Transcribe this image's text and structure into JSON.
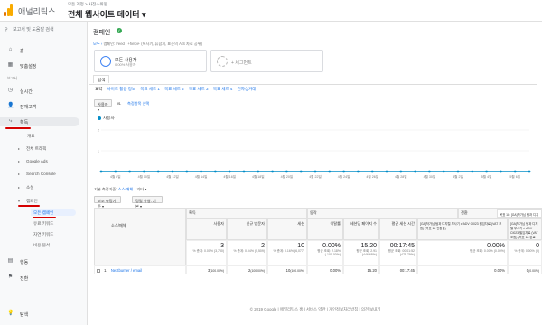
{
  "app": {
    "name": "애널리틱스",
    "breadcrumb": "모든 계정 > 사전스위밍",
    "view_title": "전체 웹사이트 데이터 ▾"
  },
  "sidebar": {
    "search_placeholder": "보고서 및 도움말 검색",
    "items": [
      {
        "label": "홈",
        "icon": "home-icon",
        "glyph": "⌂"
      },
      {
        "label": "맞춤설정",
        "icon": "grid-icon",
        "glyph": "▦"
      }
    ],
    "section_label": "보고서",
    "report_items": [
      {
        "label": "실시간",
        "icon": "clock-icon",
        "glyph": "◷"
      },
      {
        "label": "잠재고객",
        "icon": "person-icon",
        "glyph": "👤"
      },
      {
        "label": "획득",
        "icon": "acquisition-icon",
        "glyph": "⤷"
      }
    ],
    "acq_sub": [
      "개요",
      "전체 트래픽",
      "Google Ads",
      "Search Console",
      "소셜",
      "캠페인"
    ],
    "campaign_leaves": [
      "모든 캠페인",
      "유료 키워드",
      "자연 키워드",
      "비용 분석"
    ],
    "bottom_items": [
      {
        "label": "행동",
        "icon": "behavior-icon",
        "glyph": "▤"
      },
      {
        "label": "전환",
        "icon": "flag-icon",
        "glyph": "⚑"
      },
      {
        "label": "탐색",
        "icon": "lightbulb-icon",
        "glyph": "💡"
      }
    ]
  },
  "page": {
    "title": "캠페인",
    "saved_prefix": "모두 ›",
    "saved_text": "캠페인: Feed : +helpi+ (특사기, 퓨합기, 표준의 A/S 자료 공위)",
    "segments": [
      {
        "title": "모든 사용자",
        "subtitle": "0.00% 사용자"
      },
      {
        "title": "+ 세그먼트",
        "subtitle": ""
      }
    ],
    "main_tab": "탐색",
    "subtabs": [
      "요약",
      "사이트 활용 정보",
      "목표 세트 1",
      "목표 세트 2",
      "목표 세트 3",
      "목표 세트 4",
      "전자상거래"
    ]
  },
  "chart_controls": {
    "metric": "사용자 ▾",
    "vs_label": "vs.",
    "choose_metric": "측정항목 선택"
  },
  "chart_data": {
    "type": "line",
    "series": [
      {
        "name": "사용자",
        "values": [
          0,
          0,
          0,
          0,
          0,
          0,
          0,
          0,
          0,
          0,
          0,
          0,
          0,
          0,
          0,
          0,
          0,
          0,
          0,
          0,
          0,
          0,
          0,
          0,
          0,
          0,
          0,
          0,
          0,
          0,
          0
        ]
      }
    ],
    "x": [
      "4월 7일",
      "4월 8일",
      "4월 9일",
      "4월 10일",
      "4월 11일",
      "4월 12일",
      "4월 13일",
      "4월 14일",
      "4월 15일",
      "4월 16일",
      "4월 17일",
      "4월 18일",
      "4월 19일",
      "4월 20일",
      "4월 21일",
      "4월 22일",
      "4월 23일",
      "4월 24일",
      "4월 25일",
      "4월 26일",
      "4월 27일",
      "4월 28일",
      "4월 29일",
      "4월 30일",
      "5월 1일",
      "5월 2일",
      "5월 3일",
      "5월 4일",
      "5월 5일",
      "5월 6일",
      "5월 7일"
    ],
    "yticks": [
      "2",
      "1"
    ],
    "ylim": [
      0,
      2
    ],
    "color": "#058dc7"
  },
  "table_controls": {
    "primary_dim": "기본 측정기준:",
    "dim_value": "소스/매체",
    "other": "기타 ▾",
    "secondary": "보조 측정기준 ▾",
    "sort": "정렬 유형:",
    "sort_value": "기본 ▾"
  },
  "table": {
    "dim_header": "소스/매체",
    "group_acq": "획득",
    "group_behavior": "동작",
    "group_conv": "전환",
    "goal_select": "목표 18: [GA]작가님 텀과 디지털 부사기 ≠ ADV CI023 필임자료(VAT ▾",
    "columns": [
      "사용자",
      "신규 방문자",
      "세션",
      "이탈률",
      "세션당 페이지 수",
      "평균 세션 시간"
    ],
    "conv_col1": "[GA]작가님 텀과 디지털 부사기 ≠ ADV CI023 필임자료 (VAT 포함) (목표 18 전환율)",
    "conv_col2": "[GA]작가님 텀과 디지털 부사기 ≠ ADV CI023 필임자료 (VAT 포함) (목표 18 완료 수)",
    "totals": {
      "users": "3",
      "users_sub": "% 총계: 0.00% (3,730)",
      "new": "2",
      "new_sub": "% 총계: 0.04% (5,509)",
      "sessions": "10",
      "sessions_sub": "% 총계: 0.16% (6,077)",
      "bounce": "0.00%",
      "bounce_sub": "평균 조회: 2.18% (-100.00%)",
      "pps": "15.20",
      "pps_sub": "평균 조회: 2.91 (446.68%)",
      "dur": "00:17:45",
      "dur_sub": "평균 조회: 00:01:52 (475.79%)",
      "cr": "0.00%",
      "cr_sub": "평균 조회: 0.00% (0.00%)",
      "comp": "0",
      "comp_sub": "% 총계: 0.00% (0)"
    },
    "rows": [
      {
        "index": "1.",
        "source": "Nextburner / email",
        "users": "3",
        "users_pct": "(100.00%)",
        "new": "2",
        "new_pct": "(100.00%)",
        "sessions": "10",
        "sessions_pct": "(100.00%)",
        "bounce": "0.00%",
        "pps": "15.20",
        "dur": "00:17:45",
        "cr": "0.00%",
        "comp": "0",
        "comp_pct": "(0.00%)"
      }
    ]
  },
  "footer": "© 2019 Google | 애널리틱스 홈 | 서비스 약관 | 개인정보처리방침 | 의견 보내기"
}
